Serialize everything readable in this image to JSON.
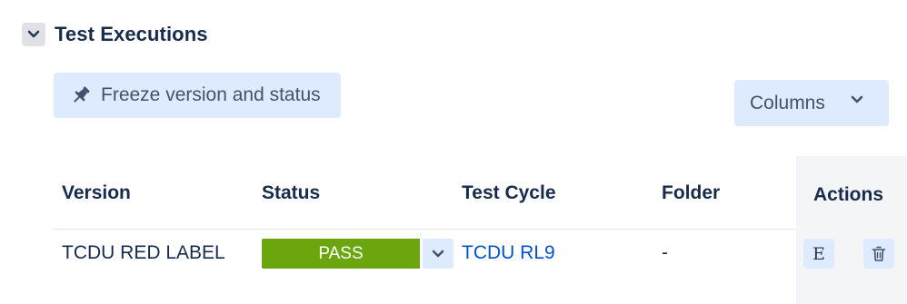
{
  "section": {
    "title": "Test Executions",
    "toggle_icon": "chevron-down-icon"
  },
  "toolbar": {
    "freeze_label": "Freeze version and status",
    "freeze_icon": "pin-icon",
    "columns_label": "Columns",
    "columns_icon": "chevron-down-icon"
  },
  "table": {
    "headers": {
      "version": "Version",
      "status": "Status",
      "test_cycle": "Test Cycle",
      "folder": "Folder",
      "actions": "Actions"
    },
    "rows": [
      {
        "version": "TCDU RED LABEL",
        "status": "PASS",
        "status_color": "#6ba60e",
        "test_cycle": "TCDU RL9",
        "folder": "-",
        "actions": {
          "execute_label": "E",
          "delete_icon": "trash-icon"
        }
      }
    ]
  },
  "colors": {
    "accent_bg": "#deebff",
    "link": "#0052cc",
    "text": "#172b4d",
    "pass": "#6ba60e"
  }
}
